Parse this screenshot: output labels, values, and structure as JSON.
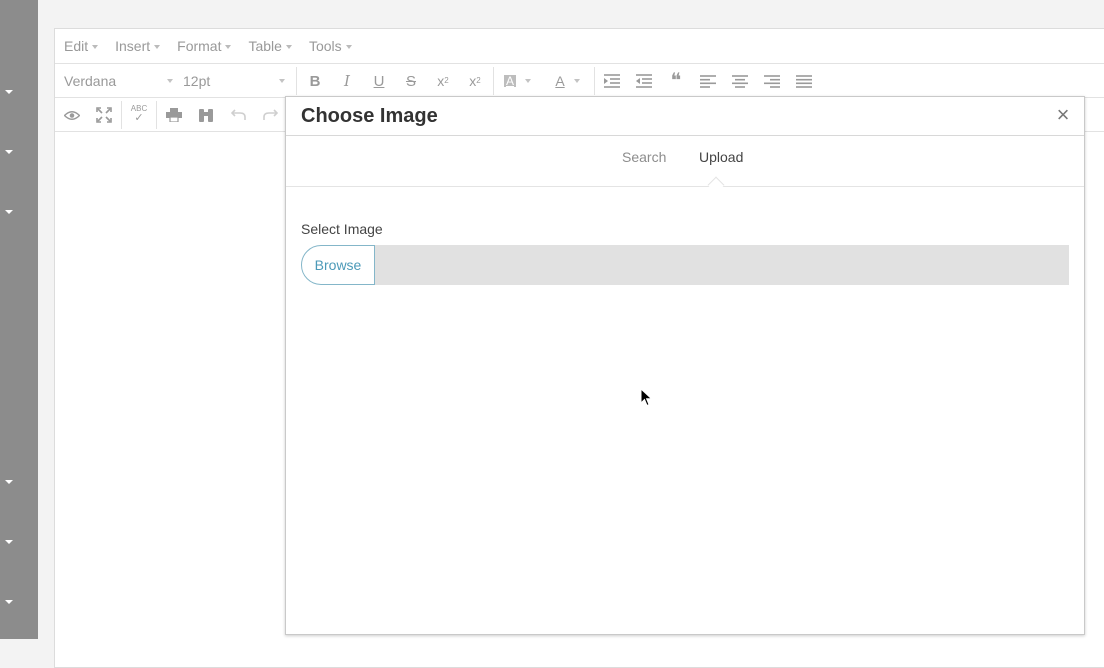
{
  "menubar": {
    "items": [
      {
        "label": "Edit"
      },
      {
        "label": "Insert"
      },
      {
        "label": "Format"
      },
      {
        "label": "Table"
      },
      {
        "label": "Tools"
      }
    ]
  },
  "toolbar": {
    "font_family": "Verdana",
    "font_size": "12pt",
    "blockquote_glyph": "❝",
    "text_color_glyph": "A",
    "bg_color_glyph": "A",
    "spellcheck_glyph": "ABC"
  },
  "dialog": {
    "title": "Choose Image",
    "close_glyph": "×",
    "tabs": [
      {
        "label": "Search",
        "active": false
      },
      {
        "label": "Upload",
        "active": true
      }
    ],
    "select_image_label": "Select Image",
    "browse_label": "Browse",
    "file_value": ""
  },
  "colors": {
    "sidebar": "#8c8c8c",
    "accent": "#4c9ab8",
    "file_field_bg": "#e1e1e1"
  }
}
